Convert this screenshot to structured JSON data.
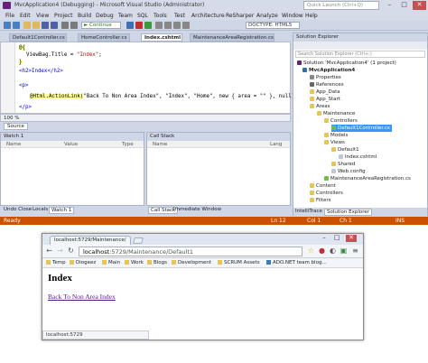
{
  "vs": {
    "title": "MvcApplication4 (Debugging) - Microsoft Visual Studio (Administrator)",
    "quick_launch_placeholder": "Quick Launch (Ctrl+Q)",
    "menu": [
      "File",
      "Edit",
      "View",
      "Project",
      "Build",
      "Debug",
      "Team",
      "SQL",
      "Tools",
      "Test",
      "Architecture",
      "ReSharper",
      "Analyze",
      "Window",
      "Help"
    ],
    "toolbar": {
      "continue_label": "Continue",
      "doctype": "DOCTYPE: HTML5"
    },
    "tabs": [
      "Default1Controller.cs",
      "HomeController.cs",
      "Index.cshtml",
      "MaintenanceAreaRegistration.cs"
    ],
    "active_tab": "Index.cshtml",
    "code": {
      "line1": "@{",
      "line2_prop": "ViewBag.Title",
      "line2_val": "\"Index\"",
      "line3": "}",
      "line4": "<h2>Index</h2>",
      "line5": "<p>",
      "line6_call": "@Html.ActionLink(",
      "line6_args": "\"Back To Non Area Index\", \"Index\", \"Home\", new { area = \"\" }, null)",
      "line7": "</p>"
    },
    "zoom": "100 %",
    "source_tab": "Source",
    "watch": {
      "title": "Watch 1",
      "cols": [
        "Name",
        "Value",
        "Type"
      ]
    },
    "callstack": {
      "title": "Call Stack",
      "cols": [
        "Name",
        "Lang"
      ]
    },
    "bottom_tabs_left": [
      "Undo Close",
      "Locals",
      "Watch 1"
    ],
    "bottom_tabs_right": [
      "Call Stack",
      "Immediate Window"
    ],
    "se": {
      "title": "Solution Explorer",
      "search_placeholder": "Search Solution Explorer (Ctrl+;)",
      "items": [
        "Solution 'MvcApplication4' (1 project)",
        "MvcApplication4",
        "Properties",
        "References",
        "App_Data",
        "App_Start",
        "Areas",
        "Maintenance",
        "Controllers",
        "Default1Controller.cs",
        "Models",
        "Views",
        "Default1",
        "Index.cshtml",
        "Shared",
        "Web.config",
        "MaintenanceAreaRegistration.cs",
        "Content",
        "Controllers",
        "Filters"
      ],
      "selected": "Default1Controller.cs",
      "bottom_tabs": [
        "IntelliTrace",
        "Solution Explorer"
      ]
    },
    "status": {
      "state": "Ready",
      "ln": "Ln 12",
      "col": "Col 1",
      "ch": "Ch 1",
      "ins": "INS"
    }
  },
  "browser": {
    "tab_title": "localhost:5729/Maintenance/",
    "url_host": "localhost",
    "url_rest": ":5729/Maintenance/Default1",
    "bookmarks": [
      "Temp",
      "Diogeez",
      "Main",
      "Work",
      "Blogs",
      "Development",
      "SCRUM Assets",
      "ADO.NET team blog..."
    ],
    "heading": "Index",
    "link": "Back To Non Area Index",
    "status_url": "localhost:5729"
  },
  "colors": {
    "accent_status": "#ca5100",
    "link_visited": "#551a8b",
    "selection": "#3399ff"
  }
}
